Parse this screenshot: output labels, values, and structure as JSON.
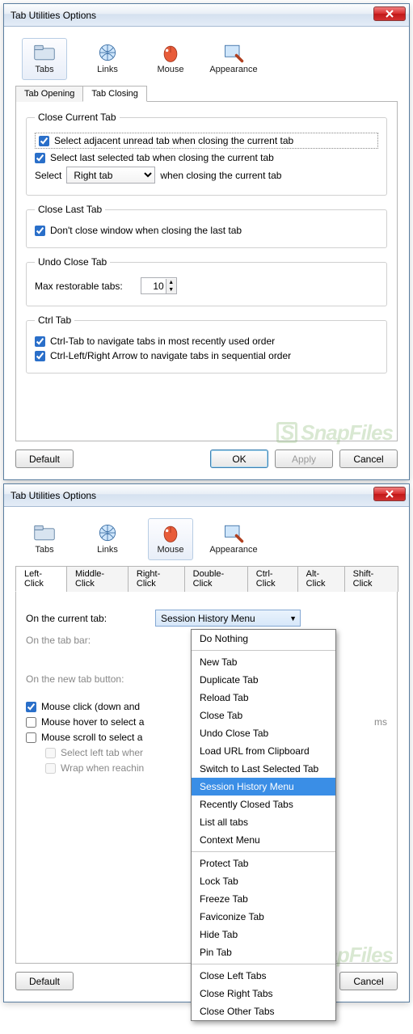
{
  "dialogTitle": "Tab Utilities Options",
  "topTabs": {
    "tabs": "Tabs",
    "links": "Links",
    "mouse": "Mouse",
    "appearance": "Appearance"
  },
  "d1": {
    "subtabs": {
      "opening": "Tab Opening",
      "closing": "Tab Closing"
    },
    "closeCurrent": {
      "legend": "Close Current Tab",
      "opt1": "Select adjacent unread tab when closing the current tab",
      "opt2": "Select last selected tab when closing the current tab",
      "selectLbl": "Select",
      "selectVal": "Right tab",
      "selectTail": "when closing the current tab"
    },
    "closeLast": {
      "legend": "Close Last Tab",
      "opt1": "Don't close window when closing the last tab"
    },
    "undo": {
      "legend": "Undo Close Tab",
      "maxLbl": "Max restorable tabs:",
      "maxVal": "10"
    },
    "ctrlTab": {
      "legend": "Ctrl Tab",
      "opt1": "Ctrl-Tab to navigate tabs in most recently used order",
      "opt2": "Ctrl-Left/Right Arrow to navigate tabs in sequential order"
    }
  },
  "d2": {
    "subtabs": [
      "Left-Click",
      "Middle-Click",
      "Right-Click",
      "Double-Click",
      "Ctrl-Click",
      "Alt-Click",
      "Shift-Click"
    ],
    "rows": {
      "current": "On the current tab:",
      "bar": "On the tab bar:",
      "newbtn": "On the new tab button:"
    },
    "ddSelected": "Session History Menu",
    "ddItems": [
      "Do Nothing",
      "",
      "New Tab",
      "Duplicate Tab",
      "Reload Tab",
      "Close Tab",
      "Undo Close Tab",
      "Load URL from Clipboard",
      "Switch to Last Selected Tab",
      "Session History Menu",
      "Recently Closed Tabs",
      "List all tabs",
      "Context Menu",
      "",
      "Protect Tab",
      "Lock Tab",
      "Freeze Tab",
      "Faviconize Tab",
      "Hide Tab",
      "Pin Tab",
      "",
      "Close Left Tabs",
      "Close Right Tabs",
      "Close Other Tabs"
    ],
    "chk": {
      "c1": "Mouse click (down and",
      "c2": "Mouse hover to select a",
      "c2tail": "ms",
      "c3": "Mouse scroll to select a",
      "c4": "Select left tab wher",
      "c5": "Wrap when reachin"
    }
  },
  "buttons": {
    "def": "Default",
    "ok": "OK",
    "apply": "Apply",
    "cancel": "Cancel"
  },
  "watermark": "SnapFiles"
}
